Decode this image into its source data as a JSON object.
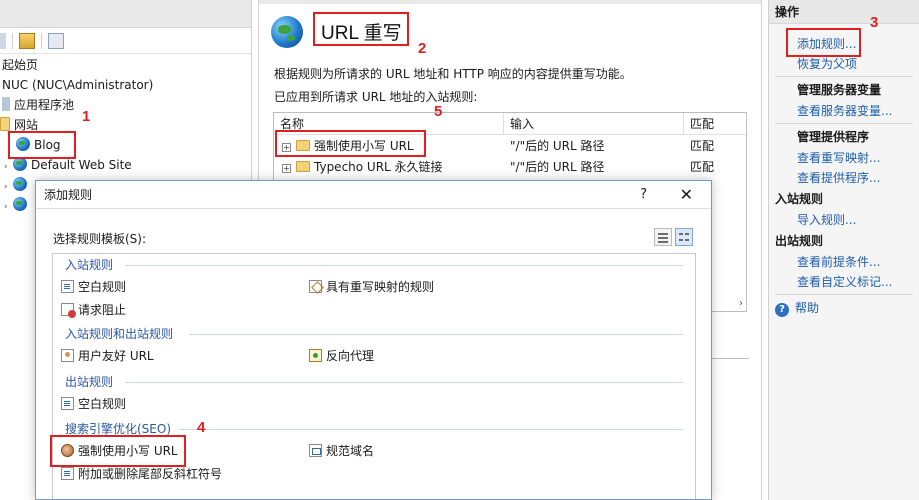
{
  "tree": {
    "items": [
      {
        "label": "起始页"
      },
      {
        "label": "NUC (NUC\\Administrator)"
      },
      {
        "label": "应用程序池"
      },
      {
        "label": "网站"
      },
      {
        "label": "Blog"
      },
      {
        "label": "Default Web Site"
      }
    ]
  },
  "main": {
    "title": "URL 重写",
    "description": "根据规则为所请求的 URL 地址和 HTTP 响应的内容提供重写功能。",
    "applied_label": "已应用到所请求 URL 地址的入站规则:",
    "columns": [
      "名称",
      "输入",
      "匹配"
    ],
    "rules": [
      {
        "name": "强制使用小写 URL",
        "input": "\"/\"后的 URL 路径",
        "match": "匹配"
      },
      {
        "name": "Typecho URL 永久链接",
        "input": "\"/\"后的 URL 路径",
        "match": "匹配"
      }
    ]
  },
  "actions": {
    "header": "操作",
    "add_rule": "添加规则...",
    "revert": "恢复为父项",
    "manage_server_vars": "管理服务器变量",
    "view_server_vars": "查看服务器变量...",
    "manage_providers": "管理提供程序",
    "view_rewrite_maps": "查看重写映射...",
    "view_providers": "查看提供程序...",
    "inbound_section": "入站规则",
    "import_rules": "导入规则...",
    "outbound_section": "出站规则",
    "view_preconditions": "查看前提条件...",
    "view_custom_tags": "查看自定义标记...",
    "help": "帮助"
  },
  "dialog": {
    "title": "添加规则",
    "help_glyph": "?",
    "close_glyph": "✕",
    "template_label": "选择规则模板(S):",
    "groups": {
      "inbound": "入站规则",
      "inbound_outbound": "入站规则和出站规则",
      "outbound": "出站规则",
      "seo": "搜索引擎优化(SEO)"
    },
    "templates": {
      "blank_rule": "空白规则",
      "rewrite_map_rule": "具有重写映射的规则",
      "request_blocking": "请求阻止",
      "user_friendly_url": "用户友好 URL",
      "reverse_proxy": "反向代理",
      "outbound_blank_rule": "空白规则",
      "lowercase_url": "强制使用小写 URL",
      "canonical_domain": "规范域名",
      "trailing_slash": "附加或删除尾部反斜杠符号"
    }
  },
  "annotations": [
    "1",
    "2",
    "3",
    "4",
    "5"
  ],
  "colors": {
    "annotation": "#e02020",
    "link": "#1f5ea8",
    "group": "#2a57a5"
  },
  "icons": [
    "globe-icon",
    "folder-icon",
    "help-icon",
    "close-icon"
  ]
}
